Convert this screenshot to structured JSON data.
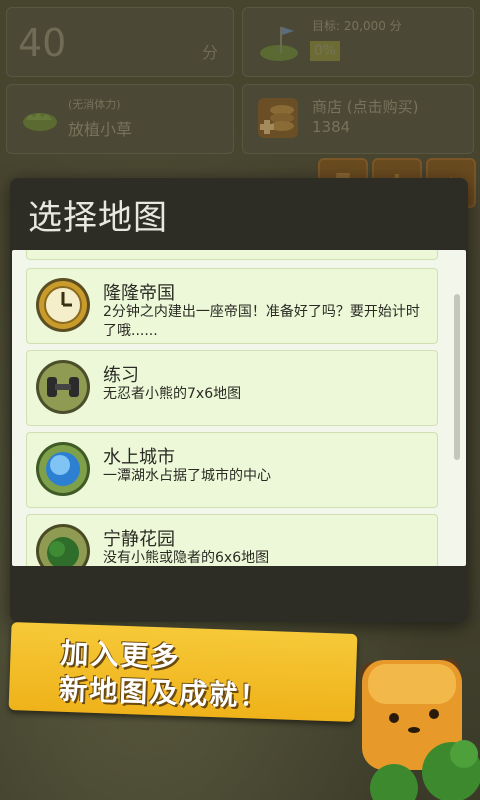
{
  "hud": {
    "score": "40",
    "score_unit": "分",
    "goal_label": "目标: 20,000 分",
    "goal_progress": "0%",
    "grass_sub": "(无消体力)",
    "grass_label": "放植小草",
    "shop_label": "商店 (点击购买)",
    "shop_coins": "1384",
    "tools": [
      "camera-icon",
      "swap-icon",
      "home-icon"
    ]
  },
  "dialog": {
    "title": "选择地图",
    "items": [
      {
        "title": "隆隆帝国",
        "desc": "2分钟之内建出一座帝国！准备好了吗？要开始计时了哦......",
        "icon": "clock-icon"
      },
      {
        "title": "练习",
        "desc": "无忍者小熊的7x6地图",
        "icon": "dumbbell-icon"
      },
      {
        "title": "水上城市",
        "desc": "一潭湖水占据了城市的中心",
        "icon": "lake-icon"
      },
      {
        "title": "宁静花园",
        "desc": "没有小熊或隐者的6x6地图",
        "icon": "tree-icon"
      }
    ]
  },
  "banner": {
    "line1": "加入更多",
    "line2": "新地图及成就！"
  },
  "colors": {
    "accent": "#efb21a",
    "item_bg": "#ecf8d8",
    "dialog_bg": "#2e2d25"
  }
}
